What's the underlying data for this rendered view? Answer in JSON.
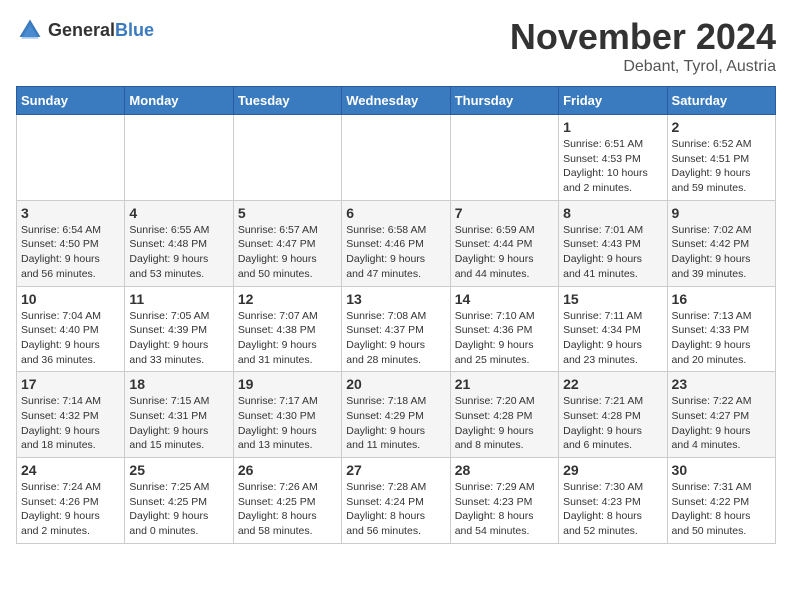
{
  "logo": {
    "text_general": "General",
    "text_blue": "Blue"
  },
  "header": {
    "month": "November 2024",
    "location": "Debant, Tyrol, Austria"
  },
  "weekdays": [
    "Sunday",
    "Monday",
    "Tuesday",
    "Wednesday",
    "Thursday",
    "Friday",
    "Saturday"
  ],
  "weeks": [
    [
      {
        "day": "",
        "info": ""
      },
      {
        "day": "",
        "info": ""
      },
      {
        "day": "",
        "info": ""
      },
      {
        "day": "",
        "info": ""
      },
      {
        "day": "",
        "info": ""
      },
      {
        "day": "1",
        "info": "Sunrise: 6:51 AM\nSunset: 4:53 PM\nDaylight: 10 hours\nand 2 minutes."
      },
      {
        "day": "2",
        "info": "Sunrise: 6:52 AM\nSunset: 4:51 PM\nDaylight: 9 hours\nand 59 minutes."
      }
    ],
    [
      {
        "day": "3",
        "info": "Sunrise: 6:54 AM\nSunset: 4:50 PM\nDaylight: 9 hours\nand 56 minutes."
      },
      {
        "day": "4",
        "info": "Sunrise: 6:55 AM\nSunset: 4:48 PM\nDaylight: 9 hours\nand 53 minutes."
      },
      {
        "day": "5",
        "info": "Sunrise: 6:57 AM\nSunset: 4:47 PM\nDaylight: 9 hours\nand 50 minutes."
      },
      {
        "day": "6",
        "info": "Sunrise: 6:58 AM\nSunset: 4:46 PM\nDaylight: 9 hours\nand 47 minutes."
      },
      {
        "day": "7",
        "info": "Sunrise: 6:59 AM\nSunset: 4:44 PM\nDaylight: 9 hours\nand 44 minutes."
      },
      {
        "day": "8",
        "info": "Sunrise: 7:01 AM\nSunset: 4:43 PM\nDaylight: 9 hours\nand 41 minutes."
      },
      {
        "day": "9",
        "info": "Sunrise: 7:02 AM\nSunset: 4:42 PM\nDaylight: 9 hours\nand 39 minutes."
      }
    ],
    [
      {
        "day": "10",
        "info": "Sunrise: 7:04 AM\nSunset: 4:40 PM\nDaylight: 9 hours\nand 36 minutes."
      },
      {
        "day": "11",
        "info": "Sunrise: 7:05 AM\nSunset: 4:39 PM\nDaylight: 9 hours\nand 33 minutes."
      },
      {
        "day": "12",
        "info": "Sunrise: 7:07 AM\nSunset: 4:38 PM\nDaylight: 9 hours\nand 31 minutes."
      },
      {
        "day": "13",
        "info": "Sunrise: 7:08 AM\nSunset: 4:37 PM\nDaylight: 9 hours\nand 28 minutes."
      },
      {
        "day": "14",
        "info": "Sunrise: 7:10 AM\nSunset: 4:36 PM\nDaylight: 9 hours\nand 25 minutes."
      },
      {
        "day": "15",
        "info": "Sunrise: 7:11 AM\nSunset: 4:34 PM\nDaylight: 9 hours\nand 23 minutes."
      },
      {
        "day": "16",
        "info": "Sunrise: 7:13 AM\nSunset: 4:33 PM\nDaylight: 9 hours\nand 20 minutes."
      }
    ],
    [
      {
        "day": "17",
        "info": "Sunrise: 7:14 AM\nSunset: 4:32 PM\nDaylight: 9 hours\nand 18 minutes."
      },
      {
        "day": "18",
        "info": "Sunrise: 7:15 AM\nSunset: 4:31 PM\nDaylight: 9 hours\nand 15 minutes."
      },
      {
        "day": "19",
        "info": "Sunrise: 7:17 AM\nSunset: 4:30 PM\nDaylight: 9 hours\nand 13 minutes."
      },
      {
        "day": "20",
        "info": "Sunrise: 7:18 AM\nSunset: 4:29 PM\nDaylight: 9 hours\nand 11 minutes."
      },
      {
        "day": "21",
        "info": "Sunrise: 7:20 AM\nSunset: 4:28 PM\nDaylight: 9 hours\nand 8 minutes."
      },
      {
        "day": "22",
        "info": "Sunrise: 7:21 AM\nSunset: 4:28 PM\nDaylight: 9 hours\nand 6 minutes."
      },
      {
        "day": "23",
        "info": "Sunrise: 7:22 AM\nSunset: 4:27 PM\nDaylight: 9 hours\nand 4 minutes."
      }
    ],
    [
      {
        "day": "24",
        "info": "Sunrise: 7:24 AM\nSunset: 4:26 PM\nDaylight: 9 hours\nand 2 minutes."
      },
      {
        "day": "25",
        "info": "Sunrise: 7:25 AM\nSunset: 4:25 PM\nDaylight: 9 hours\nand 0 minutes."
      },
      {
        "day": "26",
        "info": "Sunrise: 7:26 AM\nSunset: 4:25 PM\nDaylight: 8 hours\nand 58 minutes."
      },
      {
        "day": "27",
        "info": "Sunrise: 7:28 AM\nSunset: 4:24 PM\nDaylight: 8 hours\nand 56 minutes."
      },
      {
        "day": "28",
        "info": "Sunrise: 7:29 AM\nSunset: 4:23 PM\nDaylight: 8 hours\nand 54 minutes."
      },
      {
        "day": "29",
        "info": "Sunrise: 7:30 AM\nSunset: 4:23 PM\nDaylight: 8 hours\nand 52 minutes."
      },
      {
        "day": "30",
        "info": "Sunrise: 7:31 AM\nSunset: 4:22 PM\nDaylight: 8 hours\nand 50 minutes."
      }
    ]
  ]
}
